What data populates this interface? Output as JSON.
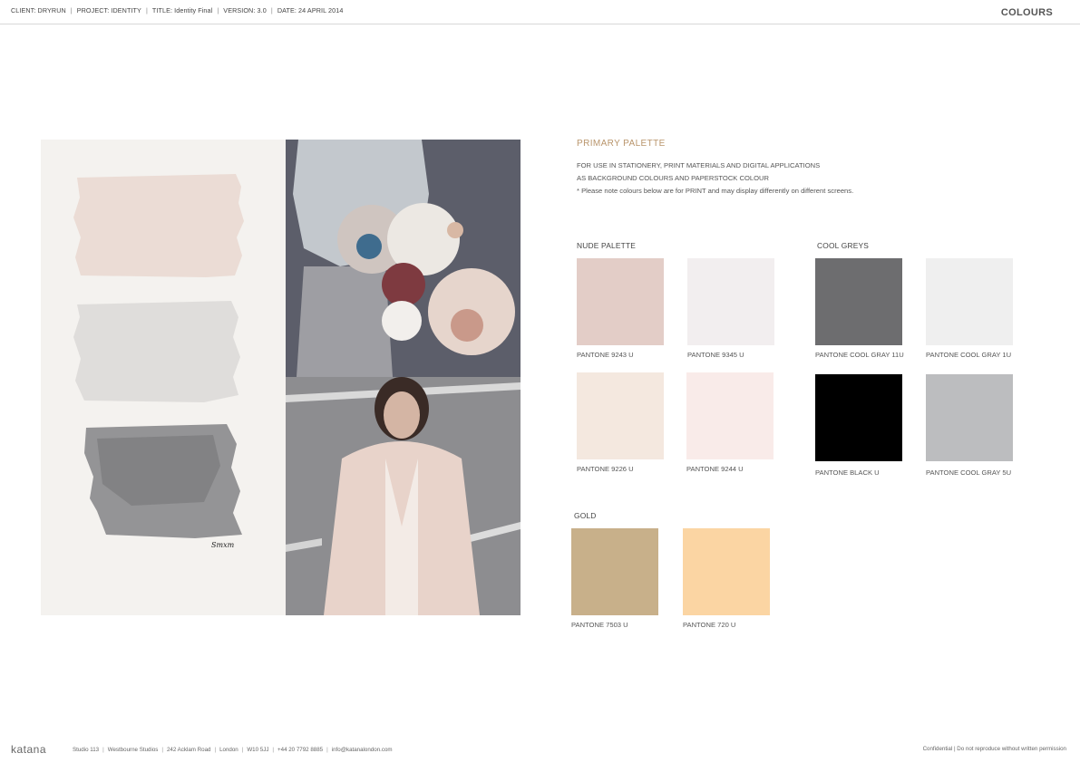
{
  "header": {
    "client": "CLIENT: DRYRUN",
    "project": "PROJECT: IDENTITY",
    "title": "TITLE: Identity Final",
    "version": "VERSION: 3.0",
    "date": "DATE: 24 APRIL 2014",
    "section": "COLOURS"
  },
  "moodboard": {
    "signature": "Smxm"
  },
  "primary": {
    "title": "PRIMARY PALETTE",
    "lines": [
      "FOR USE IN STATIONERY, PRINT MATERIALS AND DIGITAL APPLICATIONS",
      "AS BACKGROUND COLOURS AND PAPERSTOCK COLOUR",
      "* Please note colours below are for PRINT and may display differently on different screens."
    ]
  },
  "nude": {
    "label": "NUDE PALETTE",
    "swatches": [
      {
        "name": "PANTONE 9243 U",
        "color": "#e3cdc7"
      },
      {
        "name": "PANTONE 9345 U",
        "color": "#f2eeef"
      },
      {
        "name": "PANTONE 9226 U",
        "color": "#f4e8df"
      },
      {
        "name": "PANTONE 9244 U",
        "color": "#f9ebe9"
      }
    ]
  },
  "greys": {
    "label": "COOL GREYS",
    "swatches": [
      {
        "name": "PANTONE COOL GRAY 11U",
        "color": "#6d6d6f"
      },
      {
        "name": "PANTONE COOL GRAY 1U",
        "color": "#efefef"
      },
      {
        "name": "PANTONE BLACK U",
        "color": "#000000"
      },
      {
        "name": "PANTONE COOL GRAY 5U",
        "color": "#bcbdbf"
      }
    ]
  },
  "gold": {
    "label": "GOLD",
    "swatches": [
      {
        "name": "PANTONE 7503 U",
        "color": "#c8b08a"
      },
      {
        "name": "PANTONE 720 U",
        "color": "#fbd5a3"
      }
    ]
  },
  "footer": {
    "logo": "katana",
    "address": [
      "Studio 113",
      "Westbourne Studios",
      "242 Acklam Road",
      "London",
      "W10 5JJ",
      "+44 20 7792 8885",
      "info@katanalondon.com"
    ],
    "note": "Confidential | Do not reproduce without written permission"
  }
}
